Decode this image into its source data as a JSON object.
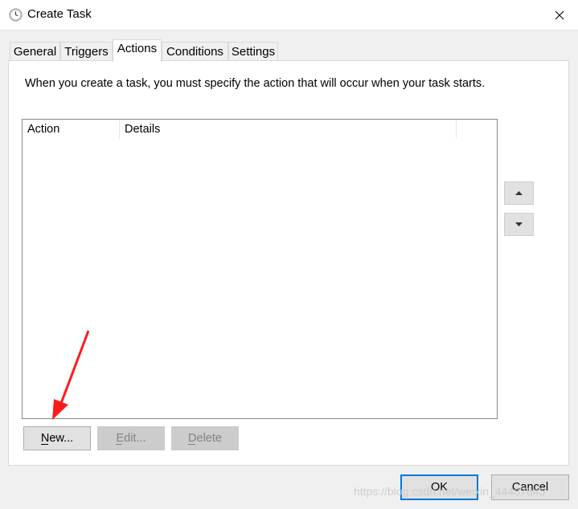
{
  "window": {
    "title": "Create Task",
    "icon": "clock-icon",
    "close_icon": "close-icon"
  },
  "tabs": [
    {
      "label": "General",
      "active": false
    },
    {
      "label": "Triggers",
      "active": false
    },
    {
      "label": "Actions",
      "active": true
    },
    {
      "label": "Conditions",
      "active": false
    },
    {
      "label": "Settings",
      "active": false
    }
  ],
  "actions_panel": {
    "intro": "When you create a task, you must specify the action that will occur when your task starts.",
    "list_columns": [
      "Action",
      "Details"
    ],
    "move_up_icon": "triangle-up-icon",
    "move_down_icon": "triangle-down-icon",
    "buttons": {
      "new": {
        "label": "New...",
        "mnemonic": "N",
        "enabled": true
      },
      "edit": {
        "label": "Edit...",
        "mnemonic": "E",
        "enabled": false
      },
      "delete": {
        "label": "Delete",
        "mnemonic": "D",
        "enabled": false
      }
    }
  },
  "footer": {
    "ok_label": "OK",
    "cancel_label": "Cancel"
  },
  "watermark": "https://blog.csdn.net/weixin_44487845",
  "colors": {
    "annotation_arrow": "#ff1a1a",
    "default_button_border": "#0078d7"
  }
}
